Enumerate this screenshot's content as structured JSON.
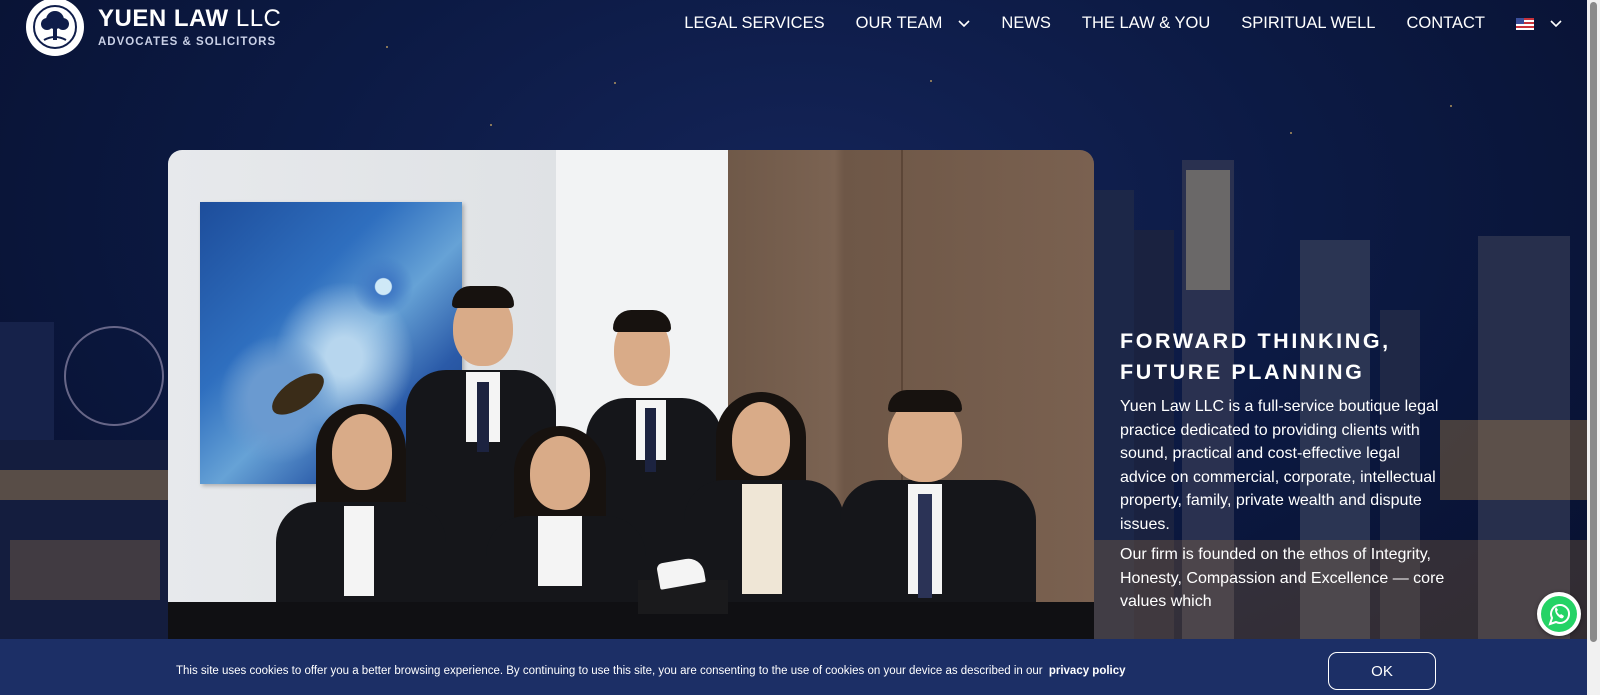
{
  "brand": {
    "name": "YUEN LAW",
    "name_suffix": "LLC",
    "tagline": "ADVOCATES & SOLICITORS",
    "logo_icon": "tree-icon"
  },
  "nav": {
    "items": [
      {
        "label": "LEGAL SERVICES"
      },
      {
        "label": "OUR TEAM",
        "has_dropdown": true
      },
      {
        "label": "NEWS"
      },
      {
        "label": "THE LAW & YOU"
      },
      {
        "label": "SPIRITUAL WELL"
      },
      {
        "label": "CONTACT"
      }
    ],
    "language_icon": "us-flag-icon"
  },
  "hero": {
    "title_line1": "FORWARD THINKING,",
    "title_line2": "FUTURE PLANNING",
    "paragraph1": "Yuen Law LLC is a full-service boutique legal practice dedicated to providing clients with sound, practical and cost-effective legal advice on commercial, corporate, intellectual property, family, private wealth and dispute issues.",
    "paragraph2": "Our firm is founded on the ethos of Integrity, Honesty, Compassion and Excellence — core values which"
  },
  "floating": {
    "whatsapp_icon": "whatsapp-icon"
  },
  "cookie": {
    "text": "This site uses cookies to offer you a better browsing experience. By continuing to use this site, you are consenting to the use of cookies on your device as described in our",
    "link_label": "privacy policy",
    "ok_label": "OK"
  },
  "colors": {
    "background": "#0c1a44",
    "cookie_bar": "#1c2f66",
    "whatsapp_green": "#25d366"
  }
}
